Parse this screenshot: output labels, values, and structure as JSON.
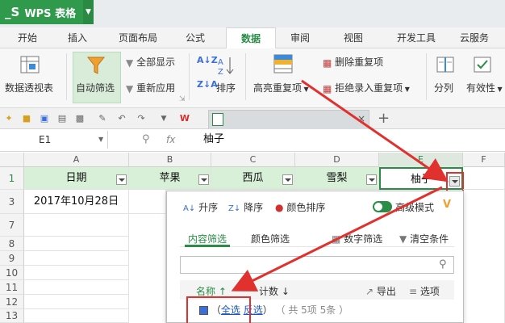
{
  "app": {
    "title": "WPS 表格"
  },
  "tabs": [
    "开始",
    "插入",
    "页面布局",
    "公式",
    "数据",
    "审阅",
    "视图",
    "开发工具",
    "云服务"
  ],
  "ribbon": {
    "pivot": "数据透视表",
    "autofilter": "自动筛选",
    "show_all": "全部显示",
    "reapply": "重新应用",
    "sort": "排序",
    "highlight_dup": "高亮重复项",
    "remove_dup": "删除重复项",
    "reject_dup": "拒绝录入重复项",
    "split": "分列",
    "validity": "有效性"
  },
  "formula_bar": {
    "cell_ref": "E1",
    "fx": "fx",
    "content": "柚子"
  },
  "columns": [
    "A",
    "B",
    "C",
    "D",
    "E",
    "F"
  ],
  "rows": [
    "1",
    "3",
    "7",
    "8",
    "9",
    "10",
    "11",
    "12",
    "13"
  ],
  "headers": [
    "日期",
    "苹果",
    "西瓜",
    "雪梨",
    "柚子"
  ],
  "row3": {
    "a": "2017年10月28日"
  },
  "popup": {
    "asc": "升序",
    "desc": "降序",
    "color_sort": "颜色排序",
    "advanced": "高级模式",
    "content_filter": "内容筛选",
    "color_filter": "颜色筛选",
    "number_filter": "数字筛选",
    "clear": "清空条件",
    "name_col": "名称",
    "count_col": "计数",
    "export": "导出",
    "options": "选项",
    "select_all": "全选",
    "invert": "反选",
    "summary": "（ 共 5项 5条 ）"
  },
  "colors": {
    "brand": "#2f9a4c",
    "accent": "#2b8c47",
    "header_fill": "#d8f0d8",
    "annotation": "#e0312e"
  }
}
